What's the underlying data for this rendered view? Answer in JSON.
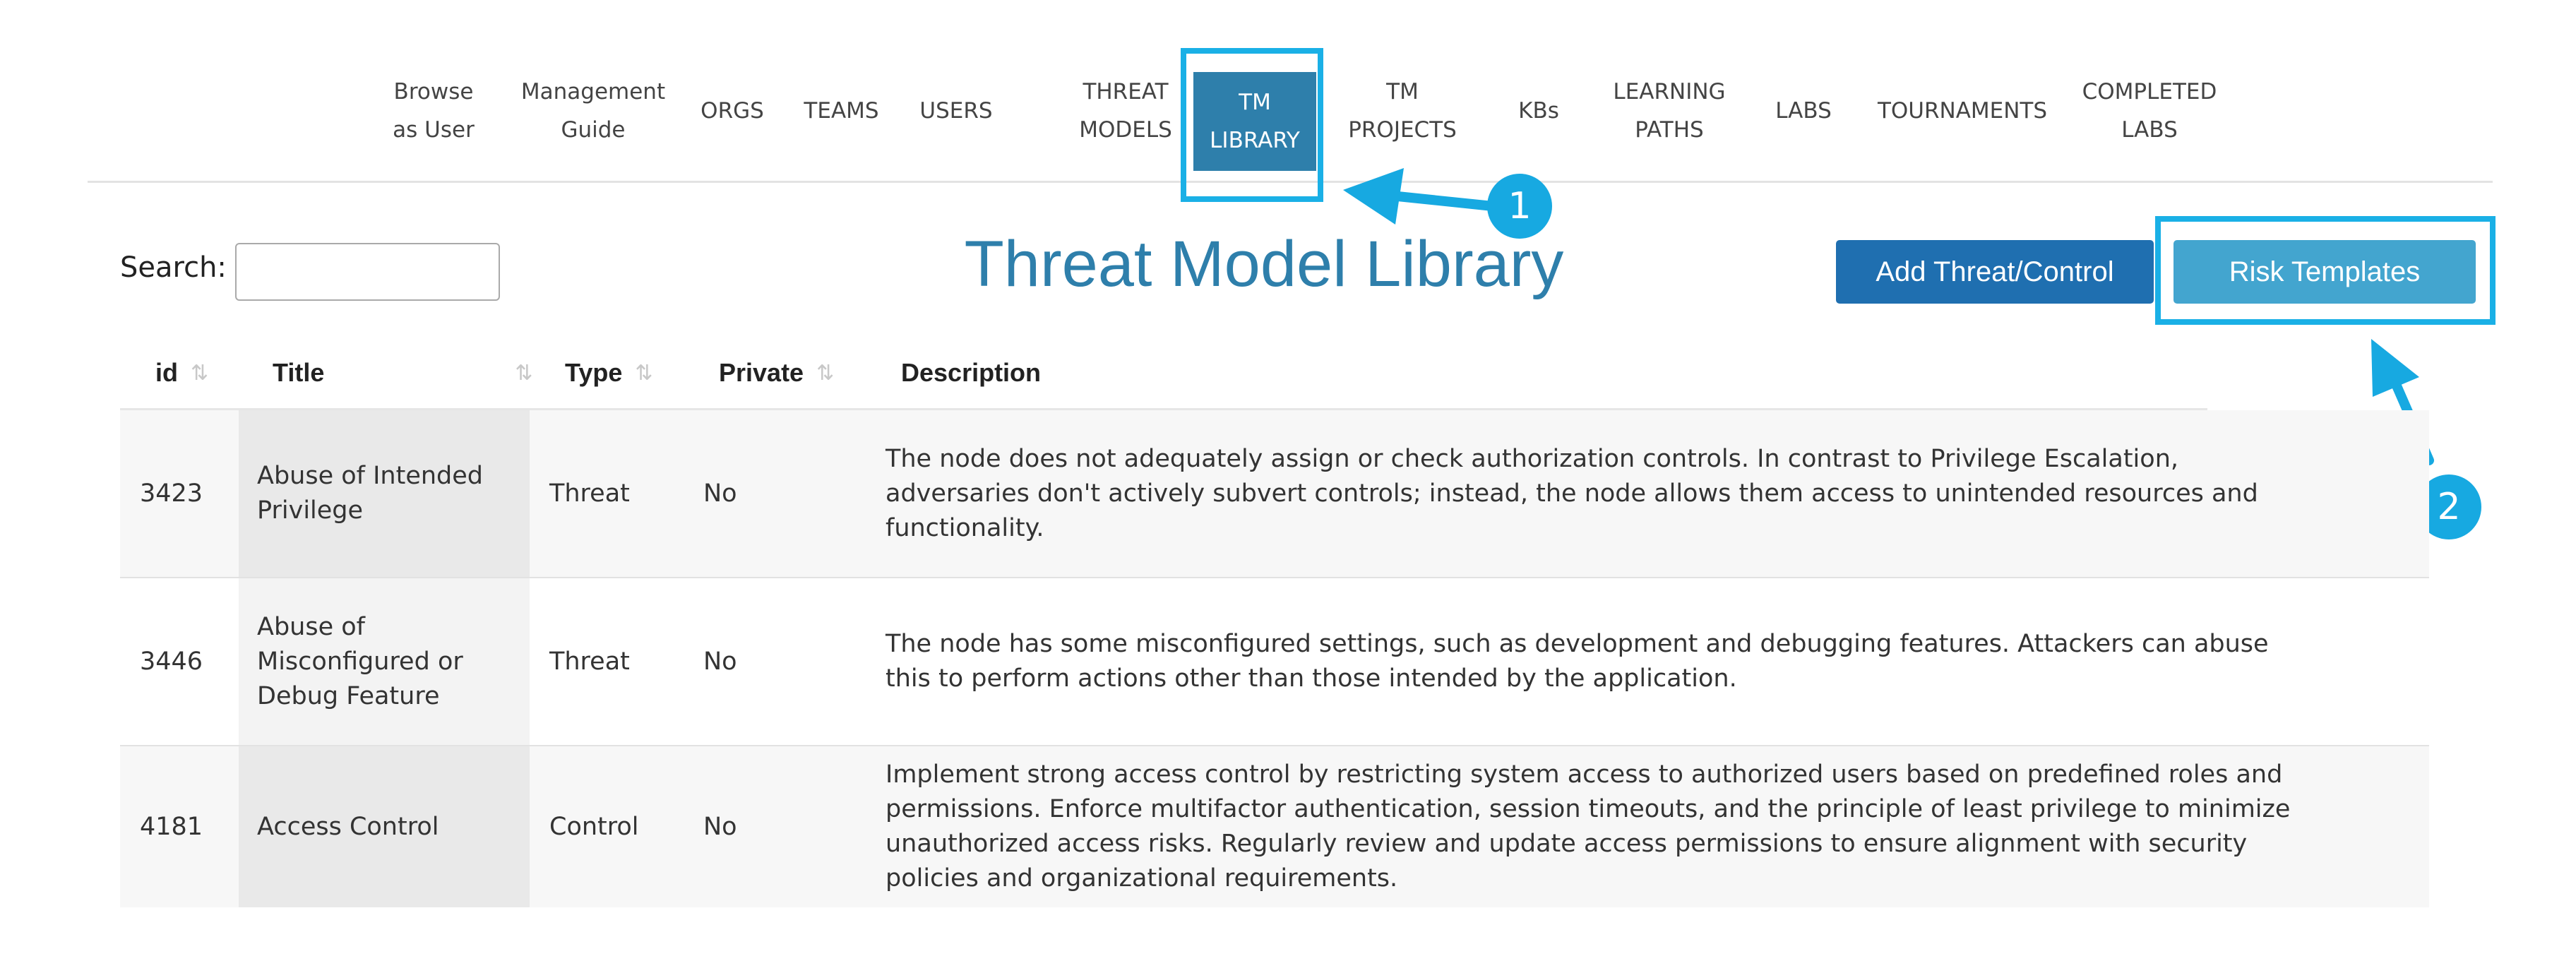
{
  "nav": {
    "items": [
      {
        "label": "Browse\nas User"
      },
      {
        "label": "Management\nGuide"
      },
      {
        "label": "ORGS"
      },
      {
        "label": "TEAMS"
      },
      {
        "label": "USERS"
      },
      {
        "label": "THREAT\nMODELS"
      },
      {
        "label": "TM\nLIBRARY",
        "active": true
      },
      {
        "label": "TM\nPROJECTS"
      },
      {
        "label": "KBs"
      },
      {
        "label": "LEARNING\nPATHS"
      },
      {
        "label": "LABS"
      },
      {
        "label": "TOURNAMENTS"
      },
      {
        "label": "COMPLETED\nLABS"
      }
    ]
  },
  "search": {
    "label": "Search:",
    "value": ""
  },
  "page_title": "Threat Model Library",
  "buttons": {
    "add": "Add Threat/Control",
    "risk": "Risk Templates"
  },
  "callouts": {
    "one": "1",
    "two": "2"
  },
  "table": {
    "columns": [
      "id",
      "Title",
      "Type",
      "Private",
      "Description"
    ],
    "rows": [
      {
        "id": "3423",
        "title": "Abuse of Intended Privilege",
        "type": "Threat",
        "private": "No",
        "description": "The node does not adequately assign or check authorization controls. In contrast to Privilege Escalation, adversaries don't actively subvert controls; instead, the node allows them access to unintended resources and functionality."
      },
      {
        "id": "3446",
        "title": "Abuse of Misconfigured or Debug Feature",
        "type": "Threat",
        "private": "No",
        "description": "The node has some misconfigured settings, such as development and debugging features. Attackers can abuse this to perform actions other than those intended by the application."
      },
      {
        "id": "4181",
        "title": "Access Control",
        "type": "Control",
        "private": "No",
        "description": "Implement strong access control by restricting system access to authorized users based on predefined roles and permissions. Enforce multifactor authentication, session timeouts, and the principle of least privilege to minimize unauthorized access risks. Regularly review and update access permissions to ensure alignment with security policies and organizational requirements."
      }
    ]
  },
  "colors": {
    "brand": "#2e7fab",
    "highlight": "#1ab0e6",
    "add_button": "#1f6fb0",
    "risk_button": "#43a5cf"
  },
  "icons": {
    "sort": "sort-arrows-icon",
    "arrow": "callout-arrow-icon"
  }
}
